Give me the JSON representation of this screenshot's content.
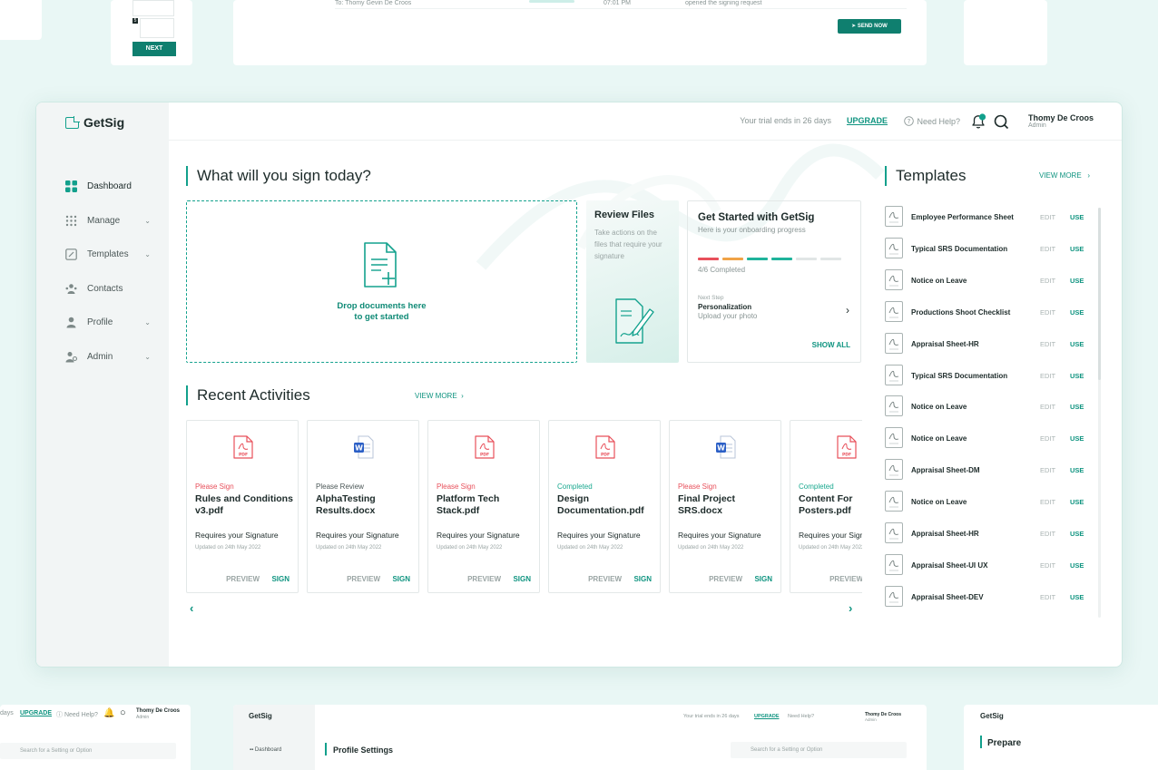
{
  "app": {
    "name": "GetSig",
    "trial_text": "Your trial ends in 26 days",
    "upgrade_label": "UPGRADE",
    "help_label": "Need Help?",
    "notification_count": "3",
    "user": {
      "name": "Thomy De Croos",
      "role": "Admin"
    }
  },
  "sidebar": {
    "items": [
      {
        "label": "Dashboard",
        "icon": "grid-icon",
        "has_submenu": false
      },
      {
        "label": "Manage",
        "icon": "dots-grid-icon",
        "has_submenu": true
      },
      {
        "label": "Templates",
        "icon": "edit-icon",
        "has_submenu": true
      },
      {
        "label": "Contacts",
        "icon": "contacts-icon",
        "has_submenu": false
      },
      {
        "label": "Profile",
        "icon": "user-icon",
        "has_submenu": true
      },
      {
        "label": "Admin",
        "icon": "admin-icon",
        "has_submenu": true
      }
    ]
  },
  "main": {
    "title": "What will you sign today?",
    "dropzone": {
      "line1": "Drop documents here",
      "line2": "to get started"
    },
    "review": {
      "title": "Review Files",
      "description": "Take actions on the files that require your signature"
    },
    "onboarding": {
      "title": "Get Started with GetSig",
      "subtitle": "Here is your onboarding progress",
      "progress_text": "4/6 Completed",
      "progress_done": 4,
      "progress_total": 6,
      "next_label": "Next Step",
      "next_step": "Personalization",
      "next_desc": "Upload your photo",
      "show_all": "SHOW ALL"
    }
  },
  "activities": {
    "title": "Recent Activities",
    "view_more": "VIEW MORE",
    "items": [
      {
        "status": "Please Sign",
        "status_color": "#e8505b",
        "name": "Rules and Conditions v3.pdf",
        "type": "pdf",
        "requirement": "Requires your Signature",
        "updated": "Updated on 24th May 2022",
        "preview": "PREVIEW",
        "sign": "SIGN"
      },
      {
        "status": "Please Review",
        "status_color": "#4b5757",
        "name": "AlphaTesting Results.docx",
        "type": "docx",
        "requirement": "Requires your Signature",
        "updated": "Updated on 24th May 2022",
        "preview": "PREVIEW",
        "sign": "SIGN"
      },
      {
        "status": "Please Sign",
        "status_color": "#e8505b",
        "name": "Platform Tech Stack.pdf",
        "type": "pdf",
        "requirement": "Requires your Signature",
        "updated": "Updated on 24th May 2022",
        "preview": "PREVIEW",
        "sign": "SIGN"
      },
      {
        "status": "Completed",
        "status_color": "#19a88f",
        "name": "Design Documentation.pdf",
        "type": "pdf",
        "requirement": "Requires your Signature",
        "updated": "Updated on 24th May 2022",
        "preview": "PREVIEW",
        "sign": "SIGN"
      },
      {
        "status": "Please Sign",
        "status_color": "#e8505b",
        "name": "Final Project SRS.docx",
        "type": "docx",
        "requirement": "Requires your Signature",
        "updated": "Updated on 24th May 2022",
        "preview": "PREVIEW",
        "sign": "SIGN"
      },
      {
        "status": "Completed",
        "status_color": "#19a88f",
        "name": "Content For Posters.pdf",
        "type": "pdf",
        "requirement": "Requires your Signature",
        "updated": "Updated on 24th May 2022",
        "preview": "PREVIEW",
        "sign": "SIGN"
      }
    ]
  },
  "templates": {
    "title": "Templates",
    "view_more": "VIEW MORE",
    "edit_label": "EDIT",
    "use_label": "USE",
    "items": [
      "Employee Performance Sheet",
      "Typical SRS Documentation",
      "Notice on Leave",
      "Productions Shoot Checklist",
      "Appraisal Sheet-HR",
      "Typical SRS Documentation",
      "Notice on Leave",
      "Notice on Leave",
      "Appraisal Sheet-DM",
      "Notice on Leave",
      "Appraisal Sheet-HR",
      "Appraisal Sheet-UI UX",
      "Appraisal Sheet-DEV"
    ]
  },
  "background": {
    "top_steps_next": "NEXT",
    "top_row_to": "To: Thomy Gevin De Croos",
    "top_row_time": "07:01 PM",
    "top_row_action": "opened the signing request",
    "top_send_now": "SEND NOW",
    "bottom_trial": "days",
    "bottom_upgrade": "UPGRADE",
    "bottom_help": "Need Help?",
    "bottom_user": "Thomy De Croos",
    "bottom_role": "Admin",
    "bottom_search": "Search for a Setting or Option",
    "bottom_app": "GetSig",
    "bottom_trial_full": "Your trial ends in 26 days",
    "bottom_dashboard": "Dashboard",
    "bottom_profile_title": "Profile Settings",
    "bottom_prepare": "Prepare"
  },
  "colors": {
    "accent": "#12a08c",
    "accent_dark": "#0f7f6f",
    "sign_red": "#e8505b"
  }
}
